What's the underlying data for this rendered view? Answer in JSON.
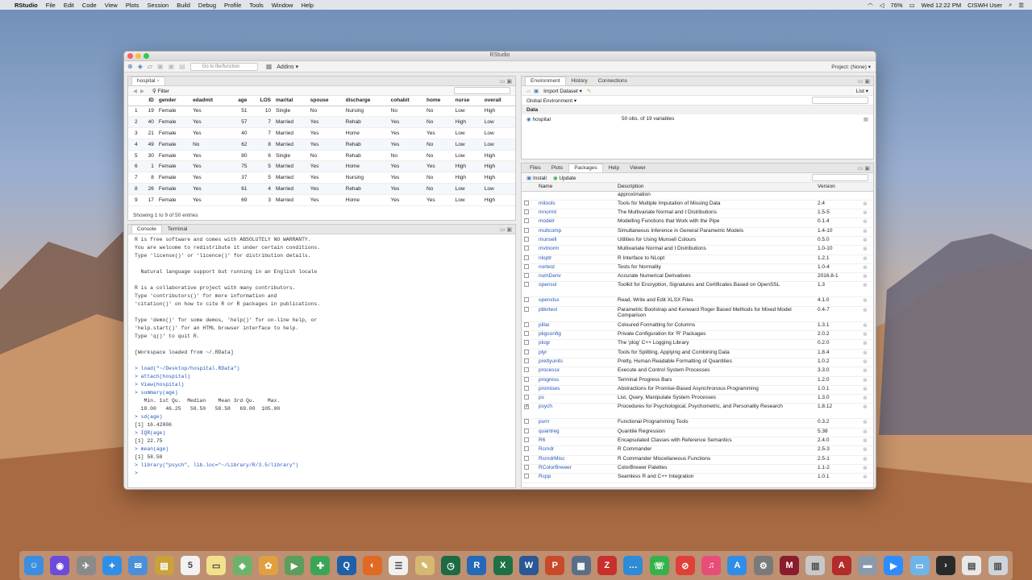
{
  "menubar": {
    "app": "RStudio",
    "items": [
      "File",
      "Edit",
      "Code",
      "View",
      "Plots",
      "Session",
      "Build",
      "Debug",
      "Profile",
      "Tools",
      "Window",
      "Help"
    ],
    "battery": "76%",
    "clock": "Wed 12:22 PM",
    "user": "CISWH User"
  },
  "window": {
    "title": "RStudio",
    "toolbar": {
      "goto_placeholder": "Go to file/function",
      "addins": "Addins",
      "project": "Project: (None)"
    }
  },
  "data_viewer": {
    "tab": "hospital",
    "filter": "Filter",
    "columns": [
      "",
      "ID",
      "gender",
      "edadmit",
      "age",
      "LOS",
      "marital",
      "spouse",
      "discharge",
      "cohabit",
      "home",
      "nurse",
      "overall"
    ],
    "rows": [
      [
        "1",
        "19",
        "Female",
        "Yes",
        "51",
        "10",
        "Single",
        "No",
        "Nursing",
        "No",
        "No",
        "Low",
        "High"
      ],
      [
        "2",
        "40",
        "Female",
        "Yes",
        "57",
        "7",
        "Married",
        "Yes",
        "Rehab",
        "Yes",
        "No",
        "High",
        "Low"
      ],
      [
        "3",
        "21",
        "Female",
        "Yes",
        "40",
        "7",
        "Married",
        "Yes",
        "Home",
        "Yes",
        "Yes",
        "Low",
        "Low"
      ],
      [
        "4",
        "49",
        "Female",
        "No",
        "62",
        "8",
        "Married",
        "Yes",
        "Rehab",
        "Yes",
        "No",
        "Low",
        "Low"
      ],
      [
        "5",
        "30",
        "Female",
        "Yes",
        "80",
        "6",
        "Single",
        "No",
        "Rehab",
        "No",
        "No",
        "Low",
        "High"
      ],
      [
        "6",
        "1",
        "Female",
        "Yes",
        "75",
        "5",
        "Married",
        "Yes",
        "Home",
        "Yes",
        "Yes",
        "High",
        "High"
      ],
      [
        "7",
        "8",
        "Female",
        "Yes",
        "37",
        "5",
        "Married",
        "Yes",
        "Nursing",
        "Yes",
        "No",
        "High",
        "High"
      ],
      [
        "8",
        "26",
        "Female",
        "Yes",
        "61",
        "4",
        "Married",
        "Yes",
        "Rehab",
        "Yes",
        "No",
        "Low",
        "Low"
      ],
      [
        "9",
        "17",
        "Female",
        "Yes",
        "69",
        "3",
        "Married",
        "Yes",
        "Home",
        "Yes",
        "Yes",
        "Low",
        "High"
      ]
    ],
    "footer": "Showing 1 to 9 of 50 entries"
  },
  "console": {
    "tabs": [
      "Console",
      "Terminal"
    ],
    "lines": [
      {
        "t": "R is free software and comes with ABSOLUTELY NO WARRANTY.",
        "c": false
      },
      {
        "t": "You are welcome to redistribute it under certain conditions.",
        "c": false
      },
      {
        "t": "Type 'license()' or 'licence()' for distribution details.",
        "c": false
      },
      {
        "t": "",
        "c": false
      },
      {
        "t": "  Natural language support but running in an English locale",
        "c": false
      },
      {
        "t": "",
        "c": false
      },
      {
        "t": "R is a collaborative project with many contributors.",
        "c": false
      },
      {
        "t": "Type 'contributors()' for more information and",
        "c": false
      },
      {
        "t": "'citation()' on how to cite R or R packages in publications.",
        "c": false
      },
      {
        "t": "",
        "c": false
      },
      {
        "t": "Type 'demo()' for some demos, 'help()' for on-line help, or",
        "c": false
      },
      {
        "t": "'help.start()' for an HTML browser interface to help.",
        "c": false
      },
      {
        "t": "Type 'q()' to quit R.",
        "c": false
      },
      {
        "t": "",
        "c": false
      },
      {
        "t": "[Workspace loaded from ~/.RData]",
        "c": false
      },
      {
        "t": "",
        "c": false
      },
      {
        "t": "> load(\"~/Desktop/hospital.RData\")",
        "c": true
      },
      {
        "t": "> attach(hospital)",
        "c": true
      },
      {
        "t": "> View(hospital)",
        "c": true
      },
      {
        "t": "> summary(age)",
        "c": true
      },
      {
        "t": "   Min. 1st Qu.  Median    Mean 3rd Qu.    Max. ",
        "c": false
      },
      {
        "t": "  18.00   46.25   58.50   58.58   69.00  105.00 ",
        "c": false
      },
      {
        "t": "> sd(age)",
        "c": true
      },
      {
        "t": "[1] 16.42806",
        "c": false
      },
      {
        "t": "> IQR(age)",
        "c": true
      },
      {
        "t": "[1] 22.75",
        "c": false
      },
      {
        "t": "> mean(age)",
        "c": true
      },
      {
        "t": "[1] 58.58",
        "c": false
      },
      {
        "t": "> library(\"psych\", lib.loc=\"~/Library/R/3.5/library\")",
        "c": true
      },
      {
        "t": "> ",
        "c": true
      }
    ]
  },
  "environment": {
    "tabs": [
      "Environment",
      "History",
      "Connections"
    ],
    "import": "Import Dataset",
    "list": "List",
    "scope": "Global Environment",
    "section": "Data",
    "object_name": "hospital",
    "object_desc": "50 obs. of 19 variables"
  },
  "files_pane": {
    "tabs": [
      "Files",
      "Plots",
      "Packages",
      "Help",
      "Viewer"
    ],
    "install": "Install",
    "update": "Update",
    "columns": [
      "Name",
      "Description",
      "Version"
    ],
    "packages": [
      {
        "n": "",
        "d": "approximation",
        "v": "",
        "k": false
      },
      {
        "n": "mitools",
        "d": "Tools for Multiple Imputation of Missing Data",
        "v": "2.4",
        "k": false
      },
      {
        "n": "mnormt",
        "d": "The Multivariate Normal and t Distributions",
        "v": "1.5-5",
        "k": false
      },
      {
        "n": "modelr",
        "d": "Modelling Functions that Work with the Pipe",
        "v": "0.1.4",
        "k": false
      },
      {
        "n": "multcomp",
        "d": "Simultaneous Inference in General Parametric Models",
        "v": "1.4-10",
        "k": false
      },
      {
        "n": "munsell",
        "d": "Utilities for Using Munsell Colours",
        "v": "0.5.0",
        "k": false
      },
      {
        "n": "mvtnorm",
        "d": "Multivariate Normal and t Distributions",
        "v": "1.0-10",
        "k": false
      },
      {
        "n": "nloptr",
        "d": "R Interface to NLopt",
        "v": "1.2.1",
        "k": false
      },
      {
        "n": "nortest",
        "d": "Tests for Normality",
        "v": "1.0-4",
        "k": false
      },
      {
        "n": "numDeriv",
        "d": "Accurate Numerical Derivatives",
        "v": "2016.8-1",
        "k": false
      },
      {
        "n": "openssl",
        "d": "Toolkit for Encryption, Signatures and Certificates Based on OpenSSL",
        "v": "1.3",
        "k": false
      },
      {
        "n": "openxlsx",
        "d": "Read, Write and Edit XLSX Files",
        "v": "4.1.0",
        "k": false
      },
      {
        "n": "pbkrtest",
        "d": "Parametric Bootstrap and Kenward Roger Based Methods for Mixed Model Comparison",
        "v": "0.4-7",
        "k": false
      },
      {
        "n": "pillar",
        "d": "Coloured Formatting for Columns",
        "v": "1.3.1",
        "k": false
      },
      {
        "n": "pkgconfig",
        "d": "Private Configuration for 'R' Packages",
        "v": "2.0.2",
        "k": false
      },
      {
        "n": "plogr",
        "d": "The 'plog' C++ Logging Library",
        "v": "0.2.0",
        "k": false
      },
      {
        "n": "plyr",
        "d": "Tools for Splitting, Applying and Combining Data",
        "v": "1.8.4",
        "k": false
      },
      {
        "n": "prettyunits",
        "d": "Pretty, Human Readable Formatting of Quantities",
        "v": "1.0.2",
        "k": false
      },
      {
        "n": "processx",
        "d": "Execute and Control System Processes",
        "v": "3.3.0",
        "k": false
      },
      {
        "n": "progress",
        "d": "Terminal Progress Bars",
        "v": "1.2.0",
        "k": false
      },
      {
        "n": "promises",
        "d": "Abstractions for Promise-Based Asynchronous Programming",
        "v": "1.0.1",
        "k": false
      },
      {
        "n": "ps",
        "d": "List, Query, Manipulate System Processes",
        "v": "1.3.0",
        "k": false
      },
      {
        "n": "psych",
        "d": "Procedures for Psychological, Psychometric, and Personality Research",
        "v": "1.8.12",
        "k": true
      },
      {
        "n": "purrr",
        "d": "Functional Programming Tools",
        "v": "0.3.2",
        "k": false
      },
      {
        "n": "quantreg",
        "d": "Quantile Regression",
        "v": "5.38",
        "k": false
      },
      {
        "n": "R6",
        "d": "Encapsulated Classes with Reference Semantics",
        "v": "2.4.0",
        "k": false
      },
      {
        "n": "Rcmdr",
        "d": "R Commander",
        "v": "2.5-3",
        "k": false
      },
      {
        "n": "RcmdrMisc",
        "d": "R Commander Miscellaneous Functions",
        "v": "2.5-1",
        "k": false
      },
      {
        "n": "RColorBrewer",
        "d": "ColorBrewer Palettes",
        "v": "1.1-2",
        "k": false
      },
      {
        "n": "Rcpp",
        "d": "Seamless R and C++ Integration",
        "v": "1.0.1",
        "k": false
      }
    ]
  },
  "dock": {
    "items": [
      {
        "name": "finder-icon",
        "color": "#3b8ee0",
        "glyph": "☺"
      },
      {
        "name": "siri-icon",
        "color": "#6b4bd8",
        "glyph": "◉"
      },
      {
        "name": "launchpad-icon",
        "color": "#8a8a8a",
        "glyph": "✈"
      },
      {
        "name": "safari-icon",
        "color": "#2f8fe8",
        "glyph": "✦"
      },
      {
        "name": "mail-icon",
        "color": "#4a90d9",
        "glyph": "✉"
      },
      {
        "name": "notes-icon",
        "color": "#c9a23a",
        "glyph": "▤"
      },
      {
        "name": "calendar-icon",
        "color": "#f2f2f2",
        "glyph": "5"
      },
      {
        "name": "stickies-icon",
        "color": "#f3e08a",
        "glyph": "▭"
      },
      {
        "name": "maps-icon",
        "color": "#6bb36b",
        "glyph": "◈"
      },
      {
        "name": "photos-icon",
        "color": "#e0a040",
        "glyph": "✿"
      },
      {
        "name": "facetime-icon",
        "color": "#5c9e5c",
        "glyph": "▶"
      },
      {
        "name": "messages-icon",
        "color": "#3aa655",
        "glyph": "✚"
      },
      {
        "name": "quicktime-icon",
        "color": "#1d5fa8",
        "glyph": "Q"
      },
      {
        "name": "firefox-icon",
        "color": "#e06a24",
        "glyph": "◐"
      },
      {
        "name": "reminders-icon",
        "color": "#f0f0f0",
        "glyph": "☰"
      },
      {
        "name": "scripts-icon",
        "color": "#d6b870",
        "glyph": "✎"
      },
      {
        "name": "timemachine-icon",
        "color": "#1c6b44",
        "glyph": "◷"
      },
      {
        "name": "r-icon",
        "color": "#2569b8",
        "glyph": "R"
      },
      {
        "name": "excel-icon",
        "color": "#1e7145",
        "glyph": "X"
      },
      {
        "name": "word-icon",
        "color": "#2b5797",
        "glyph": "W"
      },
      {
        "name": "powerpoint-icon",
        "color": "#c94a2b",
        "glyph": "P"
      },
      {
        "name": "grid-icon",
        "color": "#5a6e8a",
        "glyph": "▦"
      },
      {
        "name": "zotero-icon",
        "color": "#c8302e",
        "glyph": "Z"
      },
      {
        "name": "chat-icon",
        "color": "#2d8bd8",
        "glyph": "…"
      },
      {
        "name": "phone-icon",
        "color": "#33b34a",
        "glyph": "☏"
      },
      {
        "name": "block-icon",
        "color": "#e0403a",
        "glyph": "⊘"
      },
      {
        "name": "music-icon",
        "color": "#e84d7a",
        "glyph": "♫"
      },
      {
        "name": "appstore-icon",
        "color": "#2f8de8",
        "glyph": "A"
      },
      {
        "name": "settings-icon",
        "color": "#7a7a7a",
        "glyph": "⚙"
      },
      {
        "name": "mplus-icon",
        "color": "#8a1c2c",
        "glyph": "M"
      },
      {
        "name": "chart-icon",
        "color": "#c8c8c8",
        "glyph": "▥"
      },
      {
        "name": "acrobat-icon",
        "color": "#b32b2b",
        "glyph": "A"
      },
      {
        "name": "scanner-icon",
        "color": "#8a9aaa",
        "glyph": "▬"
      },
      {
        "name": "zoom-icon",
        "color": "#2d8cff",
        "glyph": "▶"
      },
      {
        "name": "folder-icon",
        "color": "#6fb4e8",
        "glyph": "▭"
      },
      {
        "name": "terminal-icon",
        "color": "#2a2a2a",
        "glyph": "›"
      },
      {
        "name": "documents-icon",
        "color": "#e8e8e8",
        "glyph": "▤"
      },
      {
        "name": "trash-icon",
        "color": "#cfd4da",
        "glyph": "▥"
      }
    ]
  }
}
